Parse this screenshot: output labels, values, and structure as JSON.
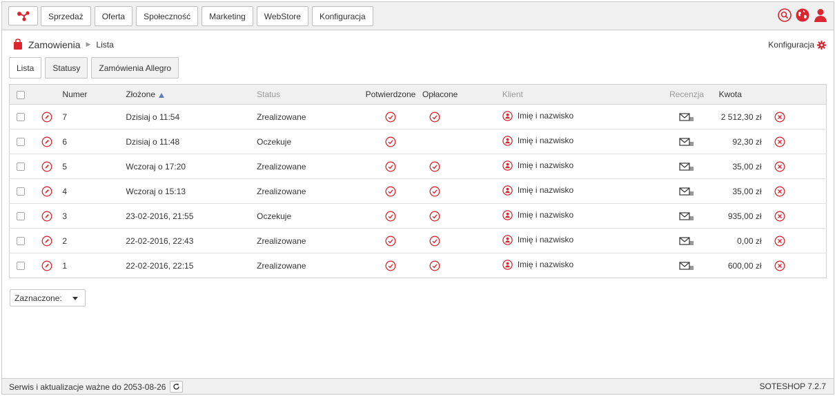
{
  "nav": {
    "items": [
      "Sprzedaż",
      "Oferta",
      "Społeczność",
      "Marketing",
      "WebStore",
      "Konfiguracja"
    ]
  },
  "header_icons": [
    "search-icon",
    "globe-icon",
    "user-icon"
  ],
  "breadcrumb": {
    "section": "Zamowienia",
    "page": "Lista"
  },
  "config_link": {
    "label": "Konfiguracja",
    "icon": "gear-icon"
  },
  "tabs": [
    "Lista",
    "Statusy",
    "Zamówienia Allegro"
  ],
  "table": {
    "columns": {
      "number": "Numer",
      "placed": "Złożone",
      "status": "Status",
      "confirmed": "Potwierdzone",
      "paid": "Opłacone",
      "client": "Klient",
      "review": "Recenzja",
      "amount": "Kwota"
    },
    "rows": [
      {
        "number": "7",
        "placed": "Dzisiaj o 11:54",
        "status": "Zrealizowane",
        "confirmed": true,
        "paid": true,
        "client": "Imię i nazwisko",
        "amount": "2 512,30 zł"
      },
      {
        "number": "6",
        "placed": "Dzisiaj o 11:48",
        "status": "Oczekuje",
        "confirmed": true,
        "paid": false,
        "client": "Imię i nazwisko",
        "amount": "92,30 zł"
      },
      {
        "number": "5",
        "placed": "Wczoraj o 17:20",
        "status": "Zrealizowane",
        "confirmed": true,
        "paid": true,
        "client": "Imię i nazwisko",
        "amount": "35,00 zł"
      },
      {
        "number": "4",
        "placed": "Wczoraj o 15:13",
        "status": "Zrealizowane",
        "confirmed": true,
        "paid": true,
        "client": "Imię i nazwisko",
        "amount": "35,00 zł"
      },
      {
        "number": "3",
        "placed": "23-02-2016, 21:55",
        "status": "Oczekuje",
        "confirmed": true,
        "paid": true,
        "client": "Imię i nazwisko",
        "amount": "935,00 zł"
      },
      {
        "number": "2",
        "placed": "22-02-2016, 22:43",
        "status": "Zrealizowane",
        "confirmed": true,
        "paid": true,
        "client": "Imię i nazwisko",
        "amount": "0,00 zł"
      },
      {
        "number": "1",
        "placed": "22-02-2016, 22:15",
        "status": "Zrealizowane",
        "confirmed": true,
        "paid": true,
        "client": "Imię i nazwisko",
        "amount": "600,00 zł"
      }
    ]
  },
  "bulk_select": {
    "label": "Zaznaczone:"
  },
  "footer": {
    "service": "Serwis i aktualizacje ważne do 2053-08-26",
    "version": "SOTESHOP 7.2.7"
  },
  "colors": {
    "accent": "#d9262f",
    "sort": "#5b7fb3"
  }
}
